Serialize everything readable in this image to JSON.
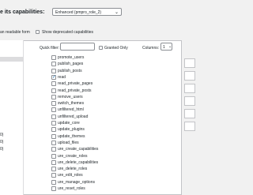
{
  "header": {
    "capabilities_label": "e its capabilities:",
    "role_select_value": "Enhanced (pmpro_role_2)",
    "readable_form_label": "an readable form",
    "show_deprecated_label": "Show deprecated capabilities"
  },
  "filter": {
    "quick_filter_label": "Quick filter:",
    "granted_only_label": "Granted Only",
    "columns_label": "Columns:",
    "columns_value": "1"
  },
  "left_items": [
    "0)",
    "0)",
    "0)"
  ],
  "capabilities": [
    {
      "label": "promote_users",
      "checked": false
    },
    {
      "label": "publish_pages",
      "checked": false
    },
    {
      "label": "publish_posts",
      "checked": false
    },
    {
      "label": "read",
      "checked": true
    },
    {
      "label": "read_private_pages",
      "checked": false
    },
    {
      "label": "read_private_posts",
      "checked": false
    },
    {
      "label": "remove_users",
      "checked": false
    },
    {
      "label": "switch_themes",
      "checked": false
    },
    {
      "label": "unfiltered_html",
      "checked": false
    },
    {
      "label": "unfiltered_upload",
      "checked": false
    },
    {
      "label": "update_core",
      "checked": false
    },
    {
      "label": "update_plugins",
      "checked": false
    },
    {
      "label": "update_themes",
      "checked": false
    },
    {
      "label": "upload_files",
      "checked": false
    },
    {
      "label": "ure_create_capabilities",
      "checked": false
    },
    {
      "label": "ure_create_roles",
      "checked": false
    },
    {
      "label": "ure_delete_capabilities",
      "checked": false
    },
    {
      "label": "ure_delete_roles",
      "checked": false
    },
    {
      "label": "ure_edit_roles",
      "checked": false
    },
    {
      "label": "ure_manage_options",
      "checked": false
    },
    {
      "label": "ure_reset_roles",
      "checked": false
    }
  ],
  "icons": {
    "dropdown": "chevron-down-icon",
    "check": "checkmark-icon"
  }
}
